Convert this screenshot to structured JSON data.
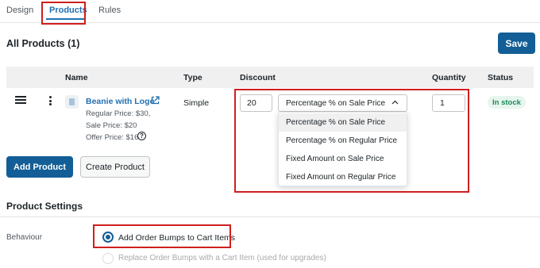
{
  "tabs": [
    {
      "label": "Design"
    },
    {
      "label": "Products"
    },
    {
      "label": "Rules"
    }
  ],
  "page_title": "All Products (1)",
  "save_label": "Save",
  "table": {
    "columns": [
      "Name",
      "Type",
      "Discount",
      "Quantity",
      "Status"
    ],
    "rows": [
      {
        "name": "Beanie with Logo",
        "regular_price": "Regular Price: $30,",
        "sale_price": "Sale Price: $20",
        "offer_price": "Offer Price: $16",
        "type": "Simple",
        "discount_value": "20",
        "discount_type": "Percentage % on Sale Price",
        "quantity": "1",
        "status": "In stock"
      }
    ]
  },
  "discount_options": [
    "Percentage % on Sale Price",
    "Percentage % on Regular Price",
    "Fixed Amount on Sale Price",
    "Fixed Amount on Regular Price"
  ],
  "buttons": {
    "add_product": "Add Product",
    "create_product": "Create Product"
  },
  "settings": {
    "title": "Product Settings",
    "behaviour_label": "Behaviour",
    "options": [
      {
        "label": "Add Order Bumps to Cart Items",
        "checked": true
      },
      {
        "label": "Replace Order Bumps with a Cart Item (used for upgrades)",
        "checked": false
      }
    ]
  },
  "help_glyph": "?",
  "colors": {
    "primary": "#135e96",
    "link": "#2271b1",
    "highlight": "#d01f1f",
    "status_bg": "#e6f6ee",
    "status_text": "#1b8a5a"
  }
}
